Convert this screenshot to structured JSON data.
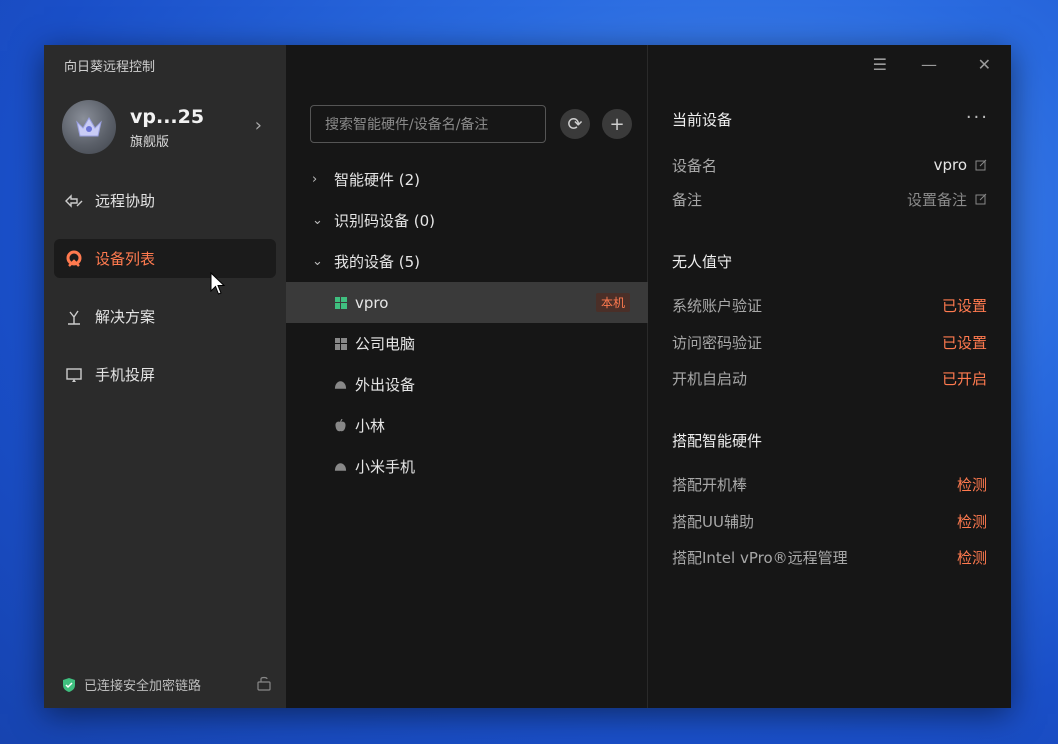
{
  "app": {
    "title": "向日葵远程控制"
  },
  "profile": {
    "name": "vp...25",
    "level": "旗舰版"
  },
  "nav": [
    {
      "label": "远程协助",
      "icon": "remote-assist-icon"
    },
    {
      "label": "设备列表",
      "icon": "device-list-icon",
      "active": true
    },
    {
      "label": "解决方案",
      "icon": "solution-icon"
    },
    {
      "label": "手机投屏",
      "icon": "screen-cast-icon"
    }
  ],
  "security": {
    "text": "已连接安全加密链路"
  },
  "search": {
    "placeholder": "搜索智能硬件/设备名/备注"
  },
  "tree": {
    "groups": [
      {
        "label": "智能硬件 (2)",
        "expanded": false
      },
      {
        "label": "识别码设备 (0)",
        "expanded": true
      },
      {
        "label": "我的设备 (5)",
        "expanded": true
      }
    ],
    "devices": [
      {
        "name": "vpro",
        "icon": "windows-icon",
        "badge": "本机"
      },
      {
        "name": "公司电脑",
        "icon": "windows-icon"
      },
      {
        "name": "外出设备",
        "icon": "android-icon"
      },
      {
        "name": "小林",
        "icon": "apple-icon"
      },
      {
        "name": "小米手机",
        "icon": "android-icon"
      }
    ]
  },
  "detail": {
    "current_title": "当前设备",
    "device_name_label": "设备名",
    "device_name_value": "vpro",
    "remark_label": "备注",
    "remark_value": "设置备注",
    "unattended_title": "无人值守",
    "unattended": [
      {
        "label": "系统账户验证",
        "value": "已设置"
      },
      {
        "label": "访问密码验证",
        "value": "已设置"
      },
      {
        "label": "开机自启动",
        "value": "已开启"
      }
    ],
    "hardware_title": "搭配智能硬件",
    "hardware": [
      {
        "label": "搭配开机棒",
        "value": "检测"
      },
      {
        "label": "搭配UU辅助",
        "value": "检测"
      },
      {
        "label": "搭配Intel vPro®远程管理",
        "value": "检测"
      }
    ]
  },
  "colors": {
    "accent": "#ff7a4f",
    "sidebar": "#2b2b2b",
    "panel": "#161616"
  }
}
